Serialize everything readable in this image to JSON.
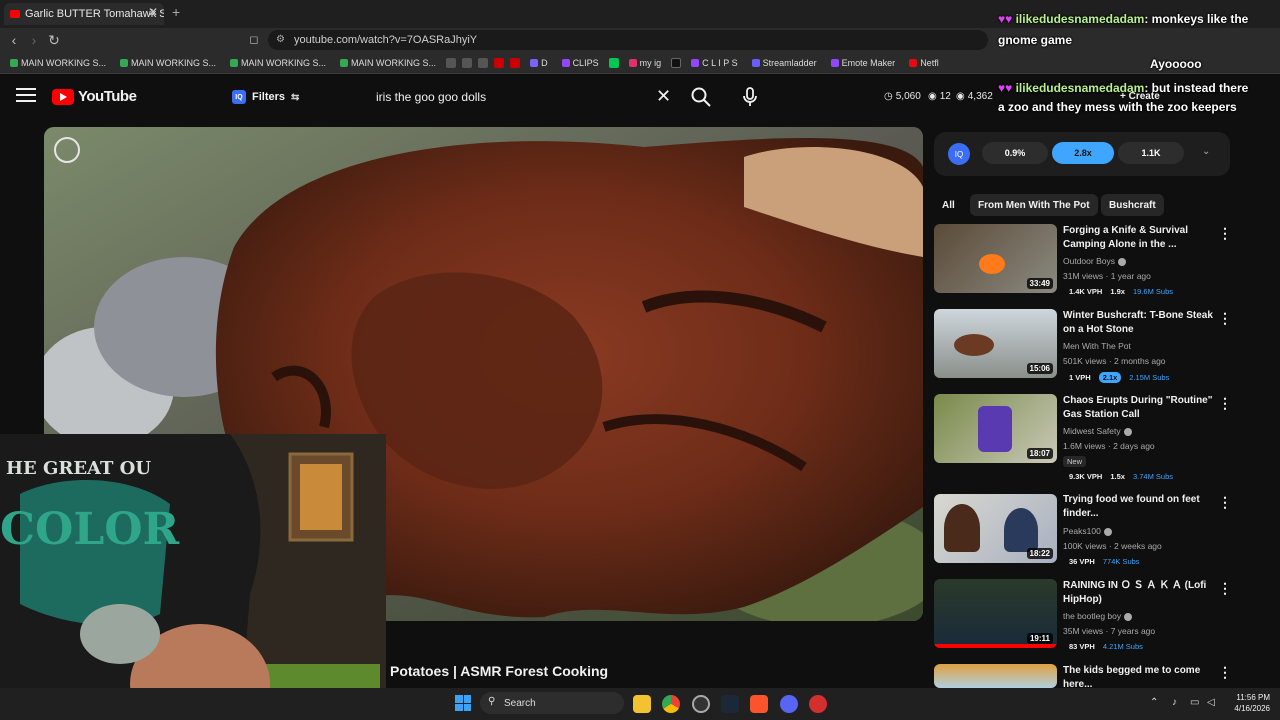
{
  "browser": {
    "tab_title": "Garlic BUTTER Tomahawk STEAK",
    "url": "youtube.com/watch?v=7OASRaJhyiY",
    "bookmarks": [
      {
        "label": "MAIN WORKING S...",
        "color": "#34a853"
      },
      {
        "label": "MAIN WORKING S...",
        "color": "#34a853"
      },
      {
        "label": "MAIN WORKING S...",
        "color": "#34a853"
      },
      {
        "label": "MAIN WORKING S...",
        "color": "#34a853"
      },
      {
        "label": "D",
        "color": "#7b61ff"
      },
      {
        "label": "CLIPS",
        "color": "#9146ff"
      },
      {
        "label": "my ig",
        "color": "#e1306c"
      },
      {
        "label": "C L I P S",
        "color": "#9146ff"
      },
      {
        "label": "Streamladder",
        "color": "#6b5cff"
      },
      {
        "label": "Emote Maker",
        "color": "#9146ff"
      },
      {
        "label": "Netfl",
        "color": "#e50914"
      }
    ]
  },
  "youtube": {
    "logo_text": "YouTube",
    "filters_label": "Filters",
    "search_query": "iris the goo goo dolls",
    "stats": {
      "views": "5,060",
      "likes": "12",
      "watching": "4,362"
    },
    "create_label": "Create"
  },
  "chat": [
    {
      "user": "ilikedudesnamedadam",
      "text": ": monkeys like the"
    },
    {
      "user": "",
      "text": "gnome game"
    },
    {
      "user": "",
      "text": "Ayooooo"
    },
    {
      "user": "ilikedudesnamedadam",
      "text": ": but instead there"
    },
    {
      "user": "",
      "text": "a zoo and they mess with the zoo keepers"
    }
  ],
  "video": {
    "title": "Potatoes | ASMR Forest Cooking",
    "webcam_shirt_text": "THE GREAT OUT COLOR"
  },
  "sidebar": {
    "rates": [
      "0.9%",
      "2.8x",
      "1.1K"
    ],
    "chips": [
      "All",
      "From Men With The Pot",
      "Bushcraft"
    ],
    "videos": [
      {
        "title": "Forging a Knife & Survival Camping Alone in the ...",
        "channel": "Outdoor Boys",
        "meta": "31M views · 1 year ago",
        "duration": "33:49",
        "vph": "1.4K VPH",
        "ratio": "1.9x",
        "ratio_hi": false,
        "subs": "19.6M Subs",
        "badge": ""
      },
      {
        "title": "Winter Bushcraft: T-Bone Steak on a Hot Stone",
        "channel": "Men With The Pot",
        "meta": "501K views · 2 months ago",
        "duration": "15:06",
        "vph": "1 VPH",
        "ratio": "2.1x",
        "ratio_hi": true,
        "subs": "2.15M Subs",
        "badge": ""
      },
      {
        "title": "Chaos Erupts During \"Routine\" Gas Station Call",
        "channel": "Midwest Safety",
        "meta": "1.6M views · 2 days ago",
        "duration": "18:07",
        "vph": "9.3K VPH",
        "ratio": "1.5x",
        "ratio_hi": false,
        "subs": "3.74M Subs",
        "badge": "New"
      },
      {
        "title": "Trying food we found on feet finder...",
        "channel": "Peaks100",
        "meta": "100K views · 2 weeks ago",
        "duration": "18:22",
        "vph": "36 VPH",
        "ratio": "",
        "ratio_hi": false,
        "subs": "774K Subs",
        "badge": ""
      },
      {
        "title": "RAINING IN Ｏ Ｓ Ａ Ｋ Ａ (Lofi HipHop)",
        "channel": "the bootleg boy",
        "meta": "35M views · 7 years ago",
        "duration": "19:11",
        "vph": "83 VPH",
        "ratio": "",
        "ratio_hi": false,
        "subs": "4.21M Subs",
        "badge": ""
      },
      {
        "title": "The kids begged me to come here...",
        "channel": "",
        "meta": "",
        "duration": "",
        "vph": "",
        "ratio": "",
        "ratio_hi": false,
        "subs": "",
        "badge": ""
      }
    ]
  },
  "taskbar": {
    "search_label": "Search",
    "time": "11:56 PM",
    "date": "4/16/2026"
  }
}
